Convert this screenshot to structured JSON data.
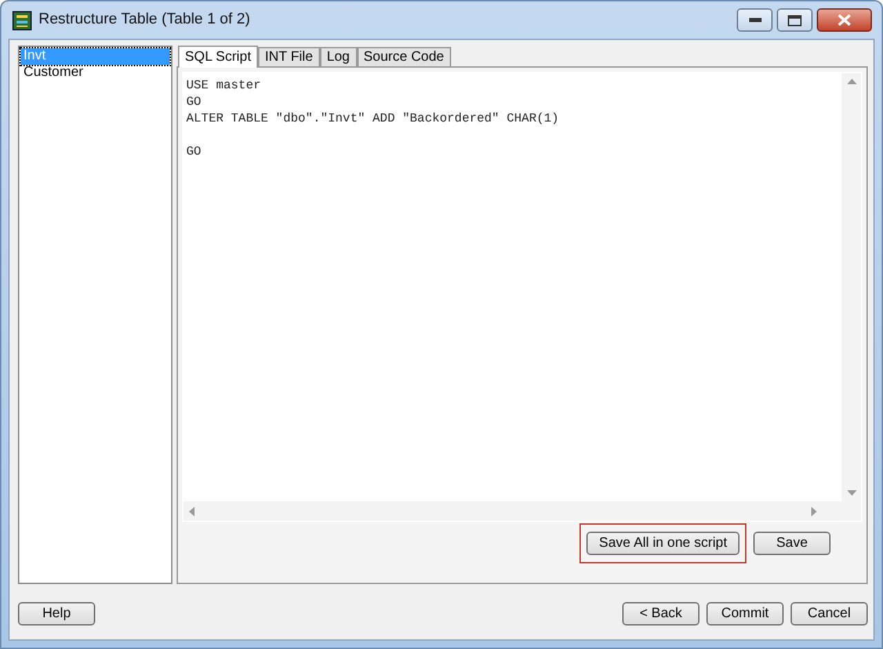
{
  "window": {
    "title": "Restructure Table (Table 1 of 2)"
  },
  "tables": [
    {
      "label": "Invt",
      "selected": true
    },
    {
      "label": "Customer",
      "selected": false
    }
  ],
  "tabs": [
    {
      "label": "SQL Script",
      "selected": true
    },
    {
      "label": "INT File",
      "selected": false
    },
    {
      "label": "Log",
      "selected": false
    },
    {
      "label": "Source Code",
      "selected": false
    }
  ],
  "sql_script": "USE master\nGO\nALTER TABLE \"dbo\".\"Invt\" ADD \"Backordered\" CHAR(1)\n\nGO",
  "panel_buttons": [
    {
      "label": "Save All in one script",
      "highlighted": true
    },
    {
      "label": "Save",
      "highlighted": false
    }
  ],
  "left_buttons": [
    "Help"
  ],
  "right_buttons": [
    "< Back",
    "Commit",
    "Cancel"
  ]
}
